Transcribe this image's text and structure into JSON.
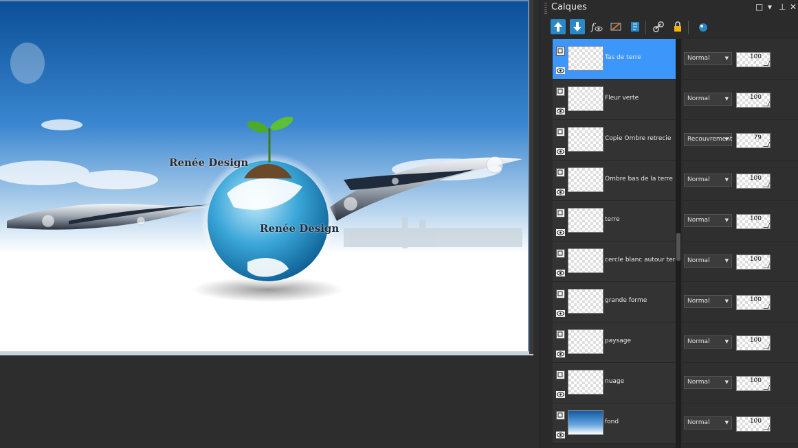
{
  "panel": {
    "title": "Calques",
    "controls": [
      "□",
      "▾",
      "⊥",
      "✕"
    ]
  },
  "toolbar": {
    "buttons": [
      {
        "name": "new-layer-up-icon",
        "color": "#3db8e6"
      },
      {
        "name": "new-layer-down-icon",
        "color": "#3db8e6"
      },
      {
        "name": "layer-effects-icon",
        "color": "#dddddd"
      },
      {
        "name": "visibility-toggle-icon",
        "color": "#e07030"
      },
      {
        "name": "layer-properties-icon",
        "color": "#3db8e6"
      },
      {
        "name": "link-icon",
        "color": "#3db8e6"
      },
      {
        "name": "lock-icon",
        "color": "#f0b400"
      },
      {
        "name": "mask-icon",
        "color": "#3db8e6"
      }
    ]
  },
  "layers": [
    {
      "name": "Tas de terre",
      "blend": "Normal",
      "opacity": "100",
      "selected": true
    },
    {
      "name": "Fleur verte",
      "blend": "Normal",
      "opacity": "100",
      "selected": false
    },
    {
      "name": "Copie Ombre retrecie",
      "blend": "Recouvrement",
      "opacity": "79",
      "selected": false
    },
    {
      "name": "Ombre bas de la terre",
      "blend": "Normal",
      "opacity": "100",
      "selected": false
    },
    {
      "name": "terre",
      "blend": "Normal",
      "opacity": "100",
      "selected": false
    },
    {
      "name": "cercle blanc autour terre",
      "blend": "Normal",
      "opacity": "100",
      "selected": false
    },
    {
      "name": "grande forme",
      "blend": "Normal",
      "opacity": "100",
      "selected": false
    },
    {
      "name": "paysage",
      "blend": "Normal",
      "opacity": "100",
      "selected": false
    },
    {
      "name": "nuage",
      "blend": "Normal",
      "opacity": "100",
      "selected": false
    },
    {
      "name": "fond",
      "blend": "Normal",
      "opacity": "100",
      "selected": false
    }
  ],
  "canvas": {
    "watermark_1": "Renée Design",
    "watermark_2": "Renée Design",
    "colors": {
      "sky_top": "#0f5aa6",
      "sky_mid": "#4a90d9",
      "horizon": "#ffffff"
    }
  },
  "colors": {
    "selected_row": "#3d97fb",
    "panel_bg": "#2b2b2b"
  }
}
